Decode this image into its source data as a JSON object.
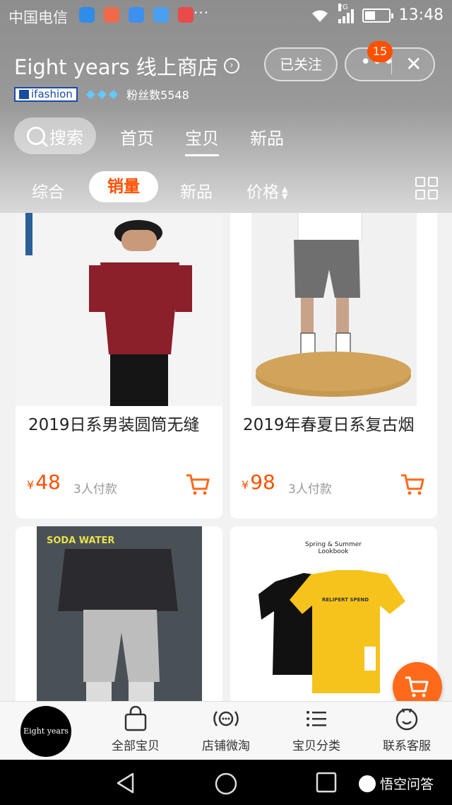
{
  "status_bar": {
    "carrier": "中国电信",
    "more_notifications": "···",
    "network": "2G",
    "time": "13:48",
    "notification_icons": [
      "browser-icon",
      "chat-icon",
      "gallery-icon",
      "message-icon",
      "weibo-icon"
    ]
  },
  "store": {
    "title": "Eight years 线上商店",
    "badge": "ifashion",
    "followers": "粉丝数5548",
    "follow_label": "已关注",
    "message_count": "15"
  },
  "nav_tabs": {
    "search_label": "搜索",
    "tabs": [
      {
        "label": "首页"
      },
      {
        "label": "宝贝"
      },
      {
        "label": "新品"
      }
    ],
    "active": "宝贝"
  },
  "sort_bar": {
    "items": [
      {
        "label": "综合"
      },
      {
        "label": "销量"
      },
      {
        "label": "新品"
      },
      {
        "label": "价格"
      }
    ],
    "active": "销量"
  },
  "products": [
    {
      "title": "2019日系男装圆筒无缝",
      "currency": "¥",
      "price": "48",
      "sold": "3人付款"
    },
    {
      "title": "2019年春夏日系复古烟",
      "currency": "¥",
      "price": "98",
      "sold": "3人付款"
    },
    {
      "image_text": "SODA WATER"
    },
    {
      "image_text_1": "Spring & Summer",
      "image_text_2": "Lookbook",
      "shirt_text": "RELIPERT SPEND"
    }
  ],
  "tabbar": {
    "store_logo_text": "Eight years",
    "items": [
      {
        "label": "全部宝贝"
      },
      {
        "label": "店铺微淘"
      },
      {
        "label": "宝贝分类"
      },
      {
        "label": "联系客服"
      }
    ]
  },
  "watermark": "悟空问答",
  "colors": {
    "accent": "#ff5000",
    "header_bg": "#9a9a9a"
  }
}
